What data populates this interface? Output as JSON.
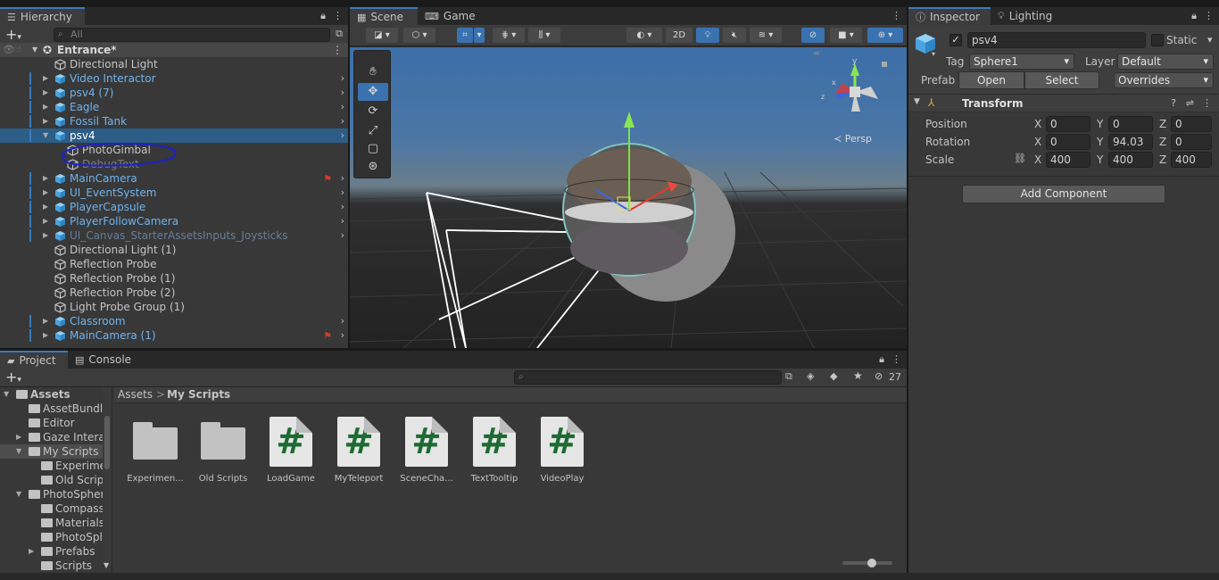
{
  "hierarchy": {
    "tab": "Hierarchy",
    "search_placeholder": "All",
    "scene_name": "Entrance*",
    "items": [
      {
        "label": "Directional Light",
        "indent": 1,
        "color": "w",
        "arrow": false,
        "prefab": false,
        "chev": false
      },
      {
        "label": "Video Interactor",
        "indent": 1,
        "color": "b",
        "arrow": true,
        "prefab": true,
        "chev": true
      },
      {
        "label": "psv4 (7)",
        "indent": 1,
        "color": "b",
        "arrow": true,
        "prefab": true,
        "chev": true
      },
      {
        "label": "Eagle",
        "indent": 1,
        "color": "b",
        "arrow": true,
        "prefab": true,
        "chev": true
      },
      {
        "label": "Fossil Tank",
        "indent": 1,
        "color": "b",
        "arrow": true,
        "prefab": true,
        "chev": true
      },
      {
        "label": "psv4",
        "indent": 1,
        "color": "b",
        "arrow": true,
        "prefab": true,
        "chev": true,
        "selected": true,
        "expanded": true
      },
      {
        "label": "PhotoGimbal",
        "indent": 2,
        "color": "w",
        "arrow": false,
        "prefab": false,
        "chev": false
      },
      {
        "label": "DebugText",
        "indent": 2,
        "color": "d",
        "arrow": false,
        "prefab": false,
        "chev": false
      },
      {
        "label": "MainCamera",
        "indent": 1,
        "color": "b",
        "arrow": true,
        "prefab": true,
        "chev": true,
        "badge": true
      },
      {
        "label": "UI_EventSystem",
        "indent": 1,
        "color": "b",
        "arrow": true,
        "prefab": true,
        "chev": true
      },
      {
        "label": "PlayerCapsule",
        "indent": 1,
        "color": "b",
        "arrow": true,
        "prefab": true,
        "chev": true
      },
      {
        "label": "PlayerFollowCamera",
        "indent": 1,
        "color": "b",
        "arrow": true,
        "prefab": true,
        "chev": true
      },
      {
        "label": "UI_Canvas_StarterAssetsInputs_Joysticks",
        "indent": 1,
        "color": "bd",
        "arrow": true,
        "prefab": true,
        "chev": true
      },
      {
        "label": "Directional Light (1)",
        "indent": 1,
        "color": "w",
        "arrow": false,
        "prefab": false,
        "chev": false
      },
      {
        "label": "Reflection Probe",
        "indent": 1,
        "color": "w",
        "arrow": false,
        "prefab": false,
        "chev": false
      },
      {
        "label": "Reflection Probe (1)",
        "indent": 1,
        "color": "w",
        "arrow": false,
        "prefab": false,
        "chev": false
      },
      {
        "label": "Reflection Probe (2)",
        "indent": 1,
        "color": "w",
        "arrow": false,
        "prefab": false,
        "chev": false
      },
      {
        "label": "Light Probe Group (1)",
        "indent": 1,
        "color": "w",
        "arrow": false,
        "prefab": false,
        "chev": false
      },
      {
        "label": "Classroom",
        "indent": 1,
        "color": "b",
        "arrow": true,
        "prefab": true,
        "chev": true
      },
      {
        "label": "MainCamera (1)",
        "indent": 1,
        "color": "b",
        "arrow": true,
        "prefab": true,
        "chev": true,
        "badge": true
      }
    ]
  },
  "scene": {
    "tabs": [
      "Scene",
      "Game"
    ],
    "toggle_2d": "2D",
    "persp_label": "≺ Persp",
    "gizmo_axes": {
      "x": "x",
      "y": "y",
      "z": "z"
    }
  },
  "inspector": {
    "tabs": [
      "Inspector",
      "Lighting"
    ],
    "object_name": "psv4",
    "static_label": "Static",
    "tag_label": "Tag",
    "tag_value": "Sphere1",
    "layer_label": "Layer",
    "layer_value": "Default",
    "prefab_label": "Prefab",
    "prefab_open": "Open",
    "prefab_select": "Select",
    "prefab_overrides": "Overrides",
    "transform_title": "Transform",
    "position_label": "Position",
    "rotation_label": "Rotation",
    "scale_label": "Scale",
    "axis_x": "X",
    "axis_y": "Y",
    "axis_z": "Z",
    "position": [
      "0",
      "0",
      "0"
    ],
    "rotation": [
      "0",
      "94.03",
      "0"
    ],
    "scale": [
      "400",
      "400",
      "400"
    ],
    "add_component": "Add Component"
  },
  "project": {
    "tabs": [
      "Project",
      "Console"
    ],
    "hidden_count": "27",
    "breadcrumb_root": "Assets",
    "breadcrumb_sep": ">",
    "breadcrumb_current": "My Scripts",
    "tree": [
      {
        "label": "Assets",
        "indent": 0,
        "arrow": "open",
        "bold": true
      },
      {
        "label": "AssetBundle",
        "indent": 1,
        "arrow": "none"
      },
      {
        "label": "Editor",
        "indent": 1,
        "arrow": "none"
      },
      {
        "label": "Gaze Intera",
        "indent": 1,
        "arrow": "closed"
      },
      {
        "label": "My Scripts",
        "indent": 1,
        "arrow": "open",
        "selected": true
      },
      {
        "label": "Experime",
        "indent": 2,
        "arrow": "none"
      },
      {
        "label": "Old Scrip",
        "indent": 2,
        "arrow": "none"
      },
      {
        "label": "PhotoSpher",
        "indent": 1,
        "arrow": "open"
      },
      {
        "label": "Compass",
        "indent": 2,
        "arrow": "none"
      },
      {
        "label": "Materials",
        "indent": 2,
        "arrow": "none"
      },
      {
        "label": "PhotoSpl",
        "indent": 2,
        "arrow": "none"
      },
      {
        "label": "Prefabs",
        "indent": 2,
        "arrow": "closed"
      },
      {
        "label": "Scripts",
        "indent": 2,
        "arrow": "none"
      }
    ],
    "files": [
      {
        "label": "Experimen...",
        "kind": "folder"
      },
      {
        "label": "Old Scripts",
        "kind": "folder"
      },
      {
        "label": "LoadGame",
        "kind": "script"
      },
      {
        "label": "MyTeleport",
        "kind": "script"
      },
      {
        "label": "SceneCha...",
        "kind": "script"
      },
      {
        "label": "TextTooltip",
        "kind": "script"
      },
      {
        "label": "VideoPlay",
        "kind": "script"
      }
    ],
    "script_glyph": "#"
  }
}
